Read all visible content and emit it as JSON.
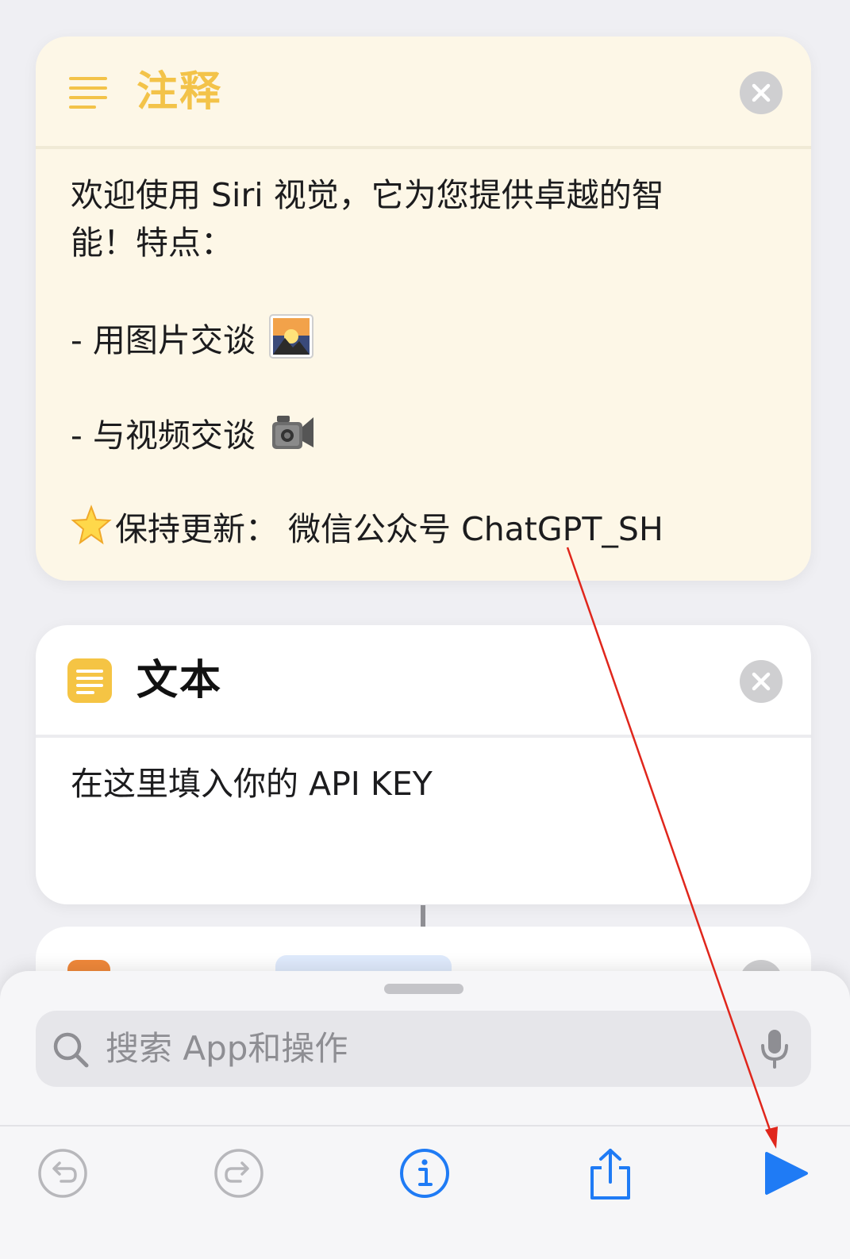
{
  "note_card": {
    "title": "注释",
    "lines": [
      "欢迎使用 Siri 视觉，它为您提供卓越的智",
      "能！特点：",
      "",
      "- 用图片交谈",
      "",
      "- 与视频交谈",
      "",
      "保持更新： 微信公众号 ChatGPT_SH"
    ],
    "icon": "list-icon",
    "emoji_icons": [
      "sunrise-mountain-icon",
      "video-camera-icon",
      "glowing-star-icon"
    ]
  },
  "text_card": {
    "title": "文本",
    "content": "在这里填入你的 API KEY",
    "icon": "text-document-icon"
  },
  "sheet": {
    "search_placeholder": "搜索 App和操作"
  },
  "toolbar": {
    "icons": [
      "undo-icon",
      "redo-icon",
      "info-icon",
      "share-icon",
      "play-icon"
    ]
  },
  "colors": {
    "note_accent": "#f3c349",
    "note_background": "#fdf7e7",
    "tint_blue": "#1f7bf5",
    "annotation_red": "#e0261c",
    "disabled_gray": "#b7b7bb"
  }
}
